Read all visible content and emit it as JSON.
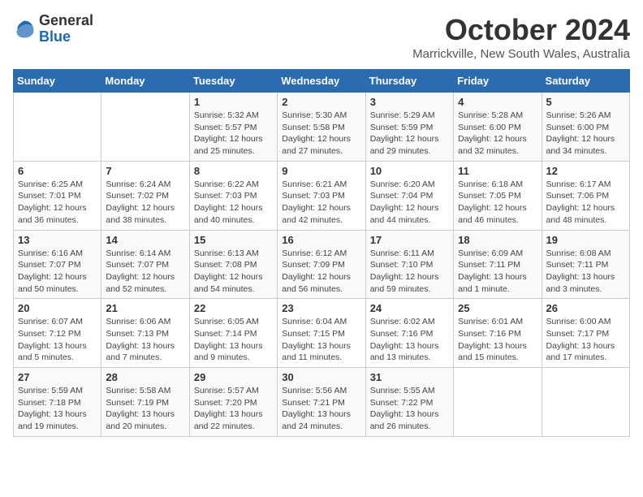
{
  "header": {
    "logo_general": "General",
    "logo_blue": "Blue",
    "month_title": "October 2024",
    "location": "Marrickville, New South Wales, Australia"
  },
  "weekdays": [
    "Sunday",
    "Monday",
    "Tuesday",
    "Wednesday",
    "Thursday",
    "Friday",
    "Saturday"
  ],
  "weeks": [
    [
      {
        "day": "",
        "info": ""
      },
      {
        "day": "",
        "info": ""
      },
      {
        "day": "1",
        "info": "Sunrise: 5:32 AM\nSunset: 5:57 PM\nDaylight: 12 hours\nand 25 minutes."
      },
      {
        "day": "2",
        "info": "Sunrise: 5:30 AM\nSunset: 5:58 PM\nDaylight: 12 hours\nand 27 minutes."
      },
      {
        "day": "3",
        "info": "Sunrise: 5:29 AM\nSunset: 5:59 PM\nDaylight: 12 hours\nand 29 minutes."
      },
      {
        "day": "4",
        "info": "Sunrise: 5:28 AM\nSunset: 6:00 PM\nDaylight: 12 hours\nand 32 minutes."
      },
      {
        "day": "5",
        "info": "Sunrise: 5:26 AM\nSunset: 6:00 PM\nDaylight: 12 hours\nand 34 minutes."
      }
    ],
    [
      {
        "day": "6",
        "info": "Sunrise: 6:25 AM\nSunset: 7:01 PM\nDaylight: 12 hours\nand 36 minutes."
      },
      {
        "day": "7",
        "info": "Sunrise: 6:24 AM\nSunset: 7:02 PM\nDaylight: 12 hours\nand 38 minutes."
      },
      {
        "day": "8",
        "info": "Sunrise: 6:22 AM\nSunset: 7:03 PM\nDaylight: 12 hours\nand 40 minutes."
      },
      {
        "day": "9",
        "info": "Sunrise: 6:21 AM\nSunset: 7:03 PM\nDaylight: 12 hours\nand 42 minutes."
      },
      {
        "day": "10",
        "info": "Sunrise: 6:20 AM\nSunset: 7:04 PM\nDaylight: 12 hours\nand 44 minutes."
      },
      {
        "day": "11",
        "info": "Sunrise: 6:18 AM\nSunset: 7:05 PM\nDaylight: 12 hours\nand 46 minutes."
      },
      {
        "day": "12",
        "info": "Sunrise: 6:17 AM\nSunset: 7:06 PM\nDaylight: 12 hours\nand 48 minutes."
      }
    ],
    [
      {
        "day": "13",
        "info": "Sunrise: 6:16 AM\nSunset: 7:07 PM\nDaylight: 12 hours\nand 50 minutes."
      },
      {
        "day": "14",
        "info": "Sunrise: 6:14 AM\nSunset: 7:07 PM\nDaylight: 12 hours\nand 52 minutes."
      },
      {
        "day": "15",
        "info": "Sunrise: 6:13 AM\nSunset: 7:08 PM\nDaylight: 12 hours\nand 54 minutes."
      },
      {
        "day": "16",
        "info": "Sunrise: 6:12 AM\nSunset: 7:09 PM\nDaylight: 12 hours\nand 56 minutes."
      },
      {
        "day": "17",
        "info": "Sunrise: 6:11 AM\nSunset: 7:10 PM\nDaylight: 12 hours\nand 59 minutes."
      },
      {
        "day": "18",
        "info": "Sunrise: 6:09 AM\nSunset: 7:11 PM\nDaylight: 13 hours\nand 1 minute."
      },
      {
        "day": "19",
        "info": "Sunrise: 6:08 AM\nSunset: 7:11 PM\nDaylight: 13 hours\nand 3 minutes."
      }
    ],
    [
      {
        "day": "20",
        "info": "Sunrise: 6:07 AM\nSunset: 7:12 PM\nDaylight: 13 hours\nand 5 minutes."
      },
      {
        "day": "21",
        "info": "Sunrise: 6:06 AM\nSunset: 7:13 PM\nDaylight: 13 hours\nand 7 minutes."
      },
      {
        "day": "22",
        "info": "Sunrise: 6:05 AM\nSunset: 7:14 PM\nDaylight: 13 hours\nand 9 minutes."
      },
      {
        "day": "23",
        "info": "Sunrise: 6:04 AM\nSunset: 7:15 PM\nDaylight: 13 hours\nand 11 minutes."
      },
      {
        "day": "24",
        "info": "Sunrise: 6:02 AM\nSunset: 7:16 PM\nDaylight: 13 hours\nand 13 minutes."
      },
      {
        "day": "25",
        "info": "Sunrise: 6:01 AM\nSunset: 7:16 PM\nDaylight: 13 hours\nand 15 minutes."
      },
      {
        "day": "26",
        "info": "Sunrise: 6:00 AM\nSunset: 7:17 PM\nDaylight: 13 hours\nand 17 minutes."
      }
    ],
    [
      {
        "day": "27",
        "info": "Sunrise: 5:59 AM\nSunset: 7:18 PM\nDaylight: 13 hours\nand 19 minutes."
      },
      {
        "day": "28",
        "info": "Sunrise: 5:58 AM\nSunset: 7:19 PM\nDaylight: 13 hours\nand 20 minutes."
      },
      {
        "day": "29",
        "info": "Sunrise: 5:57 AM\nSunset: 7:20 PM\nDaylight: 13 hours\nand 22 minutes."
      },
      {
        "day": "30",
        "info": "Sunrise: 5:56 AM\nSunset: 7:21 PM\nDaylight: 13 hours\nand 24 minutes."
      },
      {
        "day": "31",
        "info": "Sunrise: 5:55 AM\nSunset: 7:22 PM\nDaylight: 13 hours\nand 26 minutes."
      },
      {
        "day": "",
        "info": ""
      },
      {
        "day": "",
        "info": ""
      }
    ]
  ]
}
